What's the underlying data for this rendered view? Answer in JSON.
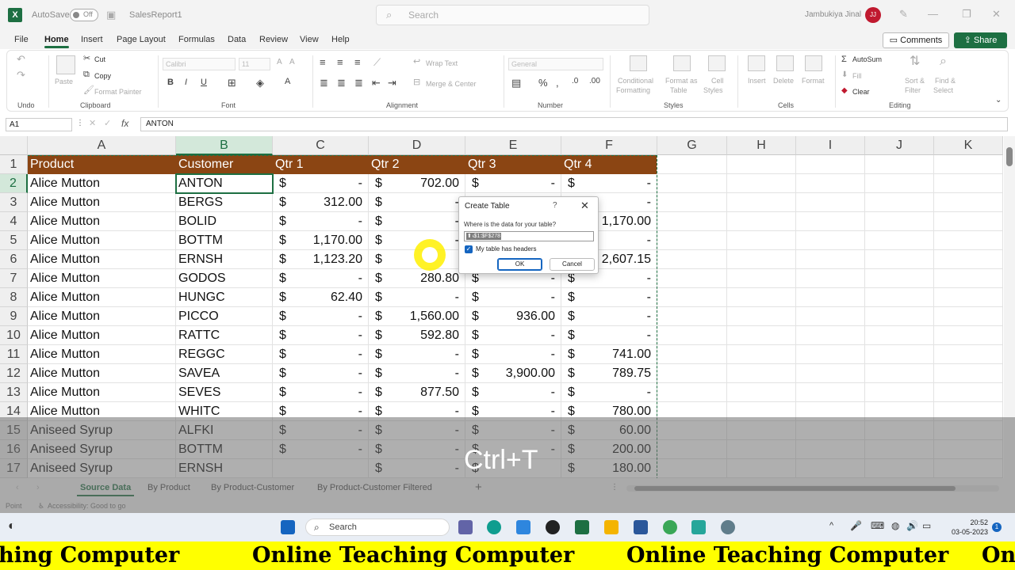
{
  "titlebar": {
    "autosave_label": "AutoSave",
    "toggle_state": "Off",
    "filename": "SalesReport1",
    "search_placeholder": "Search",
    "user_name": "Jambukiya Jinal",
    "avatar_initials": "JJ"
  },
  "menus": [
    "File",
    "Home",
    "Insert",
    "Page Layout",
    "Formulas",
    "Data",
    "Review",
    "View",
    "Help"
  ],
  "buttons": {
    "comments": "Comments",
    "share": "Share"
  },
  "ribbon": {
    "undo_group": "Undo",
    "clipboard": {
      "paste": "Paste",
      "cut": "Cut",
      "copy": "Copy",
      "format_painter": "Format Painter",
      "group": "Clipboard"
    },
    "font": {
      "name": "Calibri",
      "size": "11",
      "group": "Font",
      "bold": "B",
      "italic": "I",
      "underline": "U"
    },
    "alignment": {
      "wrap": "Wrap Text",
      "merge": "Merge & Center",
      "group": "Alignment"
    },
    "number": {
      "format": "General",
      "group": "Number"
    },
    "styles": {
      "conditional": "Conditional",
      "formatting": "Formatting",
      "format_as": "Format as",
      "table": "Table",
      "cell": "Cell",
      "cell_styles": "Styles",
      "group": "Styles"
    },
    "cells": {
      "insert": "Insert",
      "delete": "Delete",
      "format": "Format",
      "group": "Cells"
    },
    "editing": {
      "autosum": "AutoSum",
      "fill": "Fill",
      "clear": "Clear",
      "sort": "Sort &",
      "filter": "Filter",
      "find": "Find &",
      "select": "Select",
      "group": "Editing"
    }
  },
  "formula_bar": {
    "name_box": "A1",
    "fx": "fx",
    "value": "ANTON"
  },
  "columns": [
    "A",
    "B",
    "C",
    "D",
    "E",
    "F",
    "G",
    "H",
    "I",
    "J",
    "K"
  ],
  "headers": [
    "Product",
    "Customer",
    "Qtr 1",
    "Qtr 2",
    "Qtr 3",
    "Qtr 4"
  ],
  "rows": [
    {
      "n": "2",
      "p": "Alice Mutton",
      "c": "ANTON",
      "q": [
        "-",
        "702.00",
        "-",
        "-"
      ]
    },
    {
      "n": "3",
      "p": "Alice Mutton",
      "c": "BERGS",
      "q": [
        "312.00",
        "-",
        "",
        "-"
      ]
    },
    {
      "n": "4",
      "p": "Alice Mutton",
      "c": "BOLID",
      "q": [
        "-",
        "-",
        "",
        "1,170.00"
      ]
    },
    {
      "n": "5",
      "p": "Alice Mutton",
      "c": "BOTTM",
      "q": [
        "1,170.00",
        "-",
        "",
        "-"
      ]
    },
    {
      "n": "6",
      "p": "Alice Mutton",
      "c": "ERNSH",
      "q": [
        "1,123.20",
        "",
        "",
        "2,607.15"
      ]
    },
    {
      "n": "7",
      "p": "Alice Mutton",
      "c": "GODOS",
      "q": [
        "-",
        "280.80",
        "-",
        "-"
      ]
    },
    {
      "n": "8",
      "p": "Alice Mutton",
      "c": "HUNGC",
      "q": [
        "62.40",
        "-",
        "-",
        "-"
      ]
    },
    {
      "n": "9",
      "p": "Alice Mutton",
      "c": "PICCO",
      "q": [
        "-",
        "1,560.00",
        "936.00",
        "-"
      ]
    },
    {
      "n": "10",
      "p": "Alice Mutton",
      "c": "RATTC",
      "q": [
        "-",
        "592.80",
        "-",
        "-"
      ]
    },
    {
      "n": "11",
      "p": "Alice Mutton",
      "c": "REGGC",
      "q": [
        "-",
        "-",
        "-",
        "741.00"
      ]
    },
    {
      "n": "12",
      "p": "Alice Mutton",
      "c": "SAVEA",
      "q": [
        "-",
        "-",
        "3,900.00",
        "789.75"
      ]
    },
    {
      "n": "13",
      "p": "Alice Mutton",
      "c": "SEVES",
      "q": [
        "-",
        "877.50",
        "-",
        "-"
      ]
    },
    {
      "n": "14",
      "p": "Alice Mutton",
      "c": "WHITC",
      "q": [
        "-",
        "-",
        "-",
        "780.00"
      ]
    },
    {
      "n": "15",
      "p": "Aniseed Syrup",
      "c": "ALFKI",
      "q": [
        "-",
        "-",
        "-",
        "60.00"
      ]
    },
    {
      "n": "16",
      "p": "Aniseed Syrup",
      "c": "BOTTM",
      "q": [
        "-",
        "-",
        "-",
        "200.00"
      ]
    },
    {
      "n": "17",
      "p": "Aniseed Syrup",
      "c": "ERNSH",
      "q": [
        "",
        "-",
        "",
        "180.00"
      ]
    }
  ],
  "dollar": "$",
  "dialog": {
    "title": "Create Table",
    "help": "?",
    "close": "✕",
    "question": "Where is the data for your table?",
    "range": "$A$1:$F$278",
    "checkbox": "My table has headers",
    "ok": "OK",
    "cancel": "Cancel"
  },
  "sheets": [
    "Source Data",
    "By Product",
    "By Product-Customer",
    "By Product-Customer Filtered"
  ],
  "status": {
    "mode": "Point",
    "accessibility": "Accessibility: Good to go"
  },
  "overlay_text": "Ctrl+T",
  "taskbar": {
    "search": "Search",
    "time": "20:52",
    "date": "03-05-2023",
    "notifications": "1"
  },
  "banner_text": "Online Teaching Computer",
  "banner_fragment_left": "hing Computer",
  "banner_fragment_right": "On",
  "colors": {
    "excel_green": "#1d6f42",
    "header_fill": "#8b4513",
    "banner": "#ffff00",
    "cursor": "#ffff00"
  }
}
